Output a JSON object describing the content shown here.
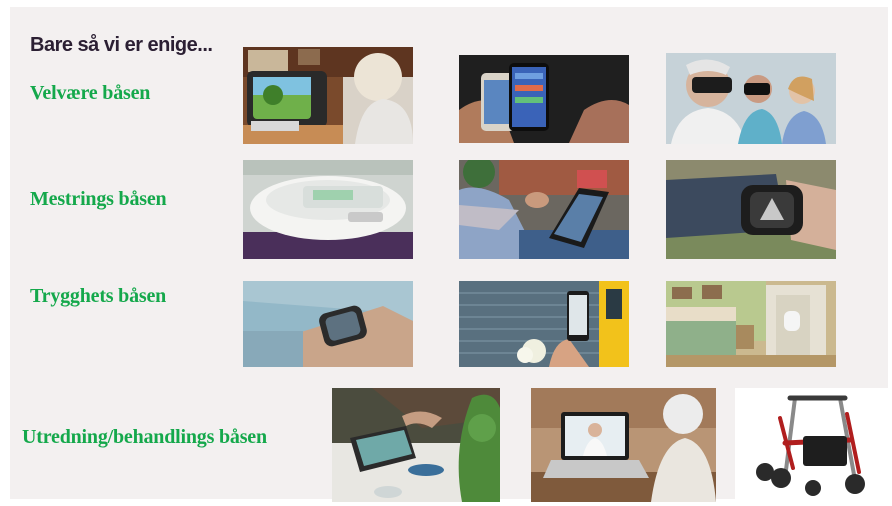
{
  "slide": {
    "title": "Bare så vi er enige...",
    "categories": [
      {
        "label": "Velvære båsen"
      },
      {
        "label": "Mestrings båsen"
      },
      {
        "label": "Trygghets båsen"
      },
      {
        "label": "Utredning/behandlings båsen"
      }
    ]
  }
}
